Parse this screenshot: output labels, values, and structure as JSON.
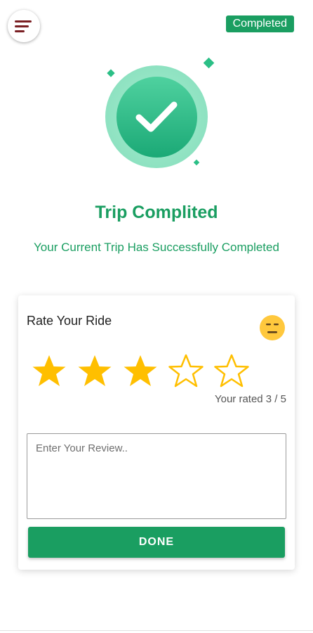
{
  "header": {
    "menu_icon": "hamburger-menu-icon",
    "status_badge": "Completed"
  },
  "hero": {
    "icon": "check-circle-icon",
    "title": "Trip Complited",
    "subtitle": "Your Current Trip Has Successfully Completed"
  },
  "rating_card": {
    "label": "Rate Your Ride",
    "mood_icon": "neutral-face-emoji-icon",
    "stars_total": 5,
    "stars_filled": 3,
    "rated_text": "Your rated 3 / 5",
    "review_placeholder": "Enter Your Review..",
    "review_value": "",
    "done_label": "DONE"
  },
  "colors": {
    "primary": "#1a9e61",
    "star": "#ffbf00",
    "badge": "#1a9e61"
  }
}
